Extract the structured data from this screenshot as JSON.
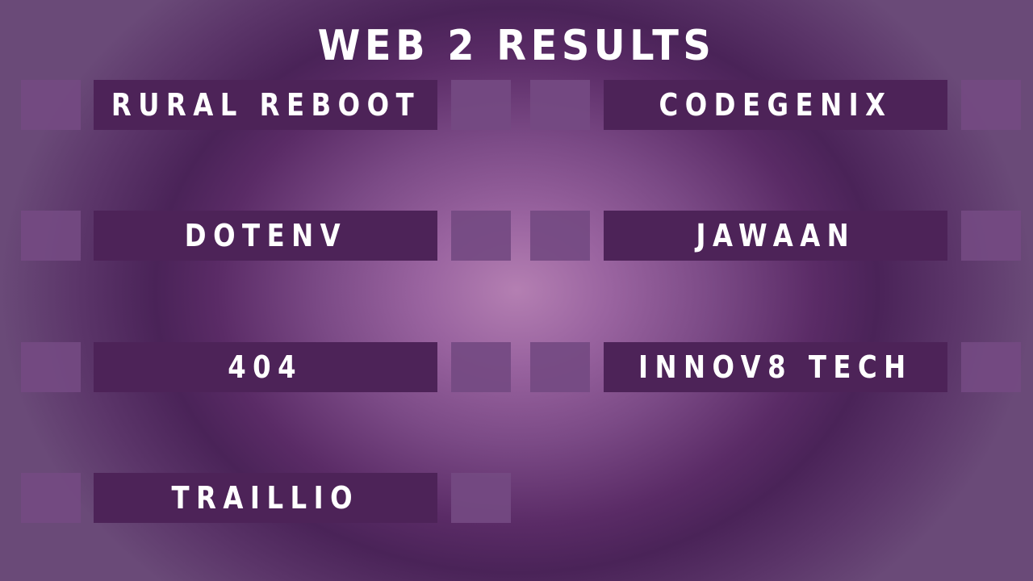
{
  "title": "WEB 2 RESULTS",
  "left_column": [
    {
      "name": "RURAL REBOOT"
    },
    {
      "name": "DOTENV"
    },
    {
      "name": "404"
    },
    {
      "name": "TRAILLIO"
    }
  ],
  "right_column": [
    {
      "name": "CODEGENIX"
    },
    {
      "name": "JAWAAN"
    },
    {
      "name": "INNOV8 TECH"
    }
  ],
  "colors": {
    "bar": "#4d2358",
    "square": "#744a82",
    "text": "#ffffff",
    "background_center": "#b47fb2",
    "background_edge": "#5a2b66"
  }
}
